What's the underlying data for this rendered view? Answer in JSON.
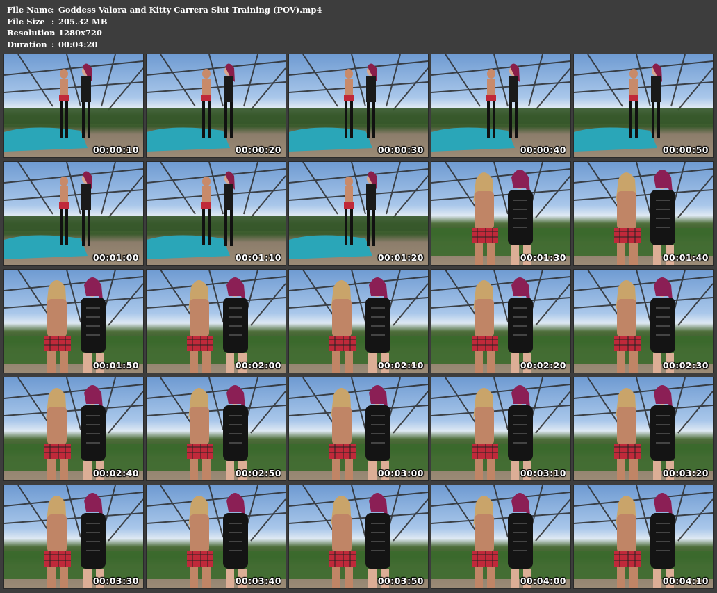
{
  "info": [
    {
      "label": "File Name",
      "value": "Goddess Valora and Kitty Carrera Slut Training (POV).mp4"
    },
    {
      "label": "File Size",
      "value": "205.32 MB"
    },
    {
      "label": "Resolution",
      "value": "1280x720"
    },
    {
      "label": "Duration",
      "value": "00:04:20"
    }
  ],
  "separator": ":",
  "thumbnails": [
    {
      "time": "00:00:10",
      "view": "wide"
    },
    {
      "time": "00:00:20",
      "view": "wide"
    },
    {
      "time": "00:00:30",
      "view": "wide"
    },
    {
      "time": "00:00:40",
      "view": "wide"
    },
    {
      "time": "00:00:50",
      "view": "wide"
    },
    {
      "time": "00:01:00",
      "view": "wide"
    },
    {
      "time": "00:01:10",
      "view": "wide"
    },
    {
      "time": "00:01:20",
      "view": "wide"
    },
    {
      "time": "00:01:30",
      "view": "close"
    },
    {
      "time": "00:01:40",
      "view": "close"
    },
    {
      "time": "00:01:50",
      "view": "close"
    },
    {
      "time": "00:02:00",
      "view": "close"
    },
    {
      "time": "00:02:10",
      "view": "close"
    },
    {
      "time": "00:02:20",
      "view": "close"
    },
    {
      "time": "00:02:30",
      "view": "close"
    },
    {
      "time": "00:02:40",
      "view": "close"
    },
    {
      "time": "00:02:50",
      "view": "close"
    },
    {
      "time": "00:03:00",
      "view": "close"
    },
    {
      "time": "00:03:10",
      "view": "close"
    },
    {
      "time": "00:03:20",
      "view": "close"
    },
    {
      "time": "00:03:30",
      "view": "close"
    },
    {
      "time": "00:03:40",
      "view": "close"
    },
    {
      "time": "00:03:50",
      "view": "close"
    },
    {
      "time": "00:04:00",
      "view": "close"
    },
    {
      "time": "00:04:10",
      "view": "close"
    }
  ]
}
